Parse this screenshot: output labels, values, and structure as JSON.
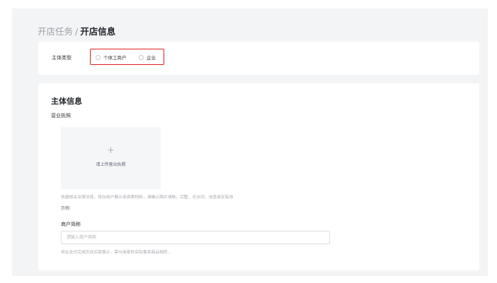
{
  "breadcrumb": {
    "parent": "开店任务",
    "separator": "/",
    "current": "开店信息"
  },
  "entity_type": {
    "label": "主体类型",
    "options": [
      {
        "label": "个体工商户",
        "selected": false
      },
      {
        "label": "企业",
        "selected": false
      }
    ],
    "highlight_color": "#e02020"
  },
  "entity_info": {
    "title": "主体信息",
    "license": {
      "label": "营业执照",
      "upload_plus": "+",
      "upload_text": "请上传营业执照",
      "hint": "依据相关法律法规，将向用户展示该资质材料，请确认照片清晰、完整、无水印、信息真实有效",
      "example_link": "示例"
    },
    "merchant_name": {
      "label": "商户简称",
      "placeholder": "请输入商户简称",
      "value": "",
      "hint": "将在支付完成页向买家展示，需与商家的实际售卖商品相符 。"
    }
  }
}
